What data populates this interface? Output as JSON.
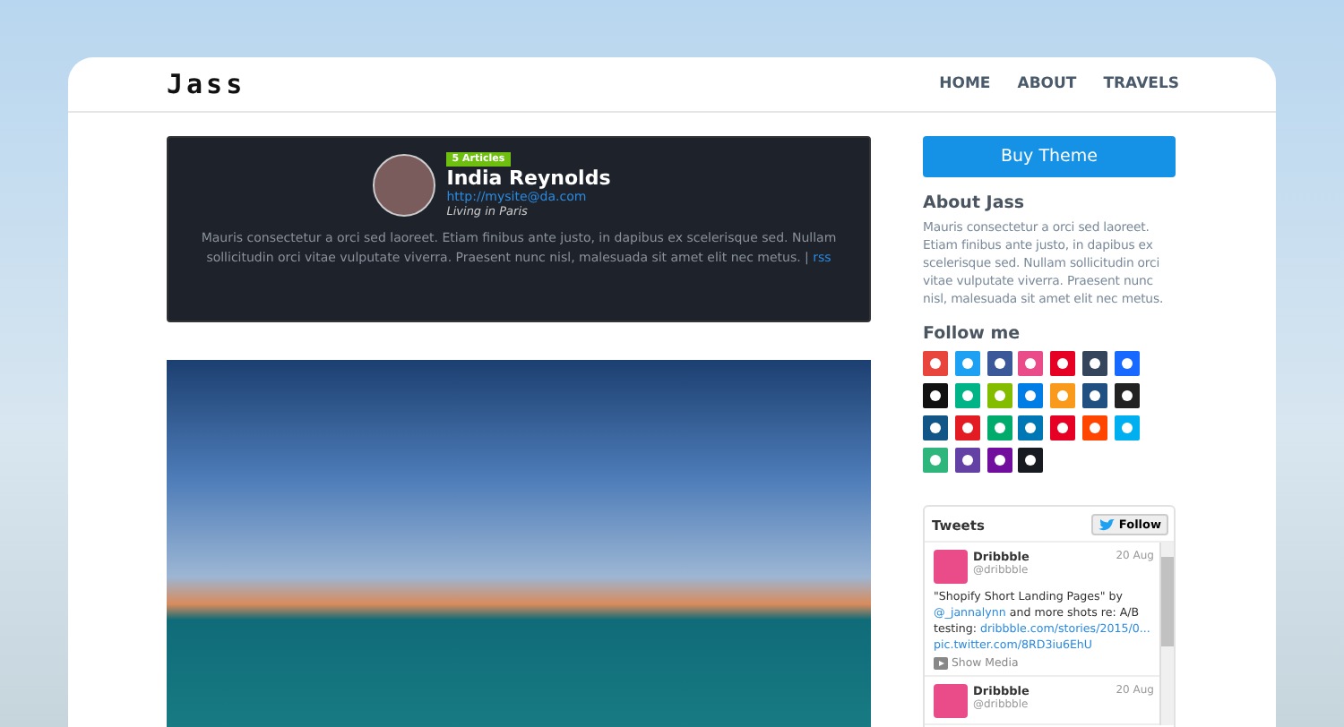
{
  "header": {
    "logo": "Jass",
    "nav": [
      {
        "label": "HOME"
      },
      {
        "label": "ABOUT"
      },
      {
        "label": "TRAVELS"
      }
    ]
  },
  "profile": {
    "badge": "5 Articles",
    "name": "India Reynolds",
    "link": "http://mysite@da.com",
    "location": "Living in Paris",
    "bio": "Mauris consectetur a orci sed laoreet. Etiam finibus ante justo, in dapibus ex scelerisque sed. Nullam sollicitudin orci vitae vulputate viverra. Praesent nunc nisl, malesuada sit amet elit nec metus. |",
    "rss": "rss"
  },
  "sidebar": {
    "button": "Buy Theme",
    "about_title": "About Jass",
    "about_text": "Mauris consectetur a orci sed laoreet. Etiam finibus ante justo, in dapibus ex scelerisque sed. Nullam sollicitudin orci vitae vulputate viverra. Praesent nunc nisl, malesuada sit amet elit nec metus.",
    "follow_title": "Follow me",
    "social": [
      {
        "color": "#e8453c"
      },
      {
        "color": "#1da1f2"
      },
      {
        "color": "#3b5998"
      },
      {
        "color": "#ea4c89"
      },
      {
        "color": "#e60023"
      },
      {
        "color": "#35465c"
      },
      {
        "color": "#1769ff"
      },
      {
        "color": "#111111"
      },
      {
        "color": "#00b488"
      },
      {
        "color": "#84bd00"
      },
      {
        "color": "#007ee5"
      },
      {
        "color": "#f99a1c"
      },
      {
        "color": "#205081"
      },
      {
        "color": "#222222"
      },
      {
        "color": "#125688"
      },
      {
        "color": "#e31b23"
      },
      {
        "color": "#00ab6c"
      },
      {
        "color": "#0077b5"
      },
      {
        "color": "#e60023"
      },
      {
        "color": "#ff4500"
      },
      {
        "color": "#00aff0"
      },
      {
        "color": "#2eb67d"
      },
      {
        "color": "#6441a5"
      },
      {
        "color": "#720e9e"
      },
      {
        "color": "#171a21"
      }
    ],
    "tweets": {
      "title": "Tweets",
      "follow": "Follow",
      "items": [
        {
          "name": "Dribbble",
          "handle": "@dribbble",
          "date": "20 Aug",
          "text": "\"Shopify Short Landing Pages\" by",
          "mention": "@_jannalynn",
          "text2": "and more shots re: A/B testing:",
          "url": "dribbble.com/stories/2015/0...",
          "pic": "pic.twitter.com/8RD3iu6EhU",
          "media": "Show Media"
        },
        {
          "name": "Dribbble",
          "handle": "@dribbble",
          "date": "20 Aug"
        }
      ]
    }
  }
}
